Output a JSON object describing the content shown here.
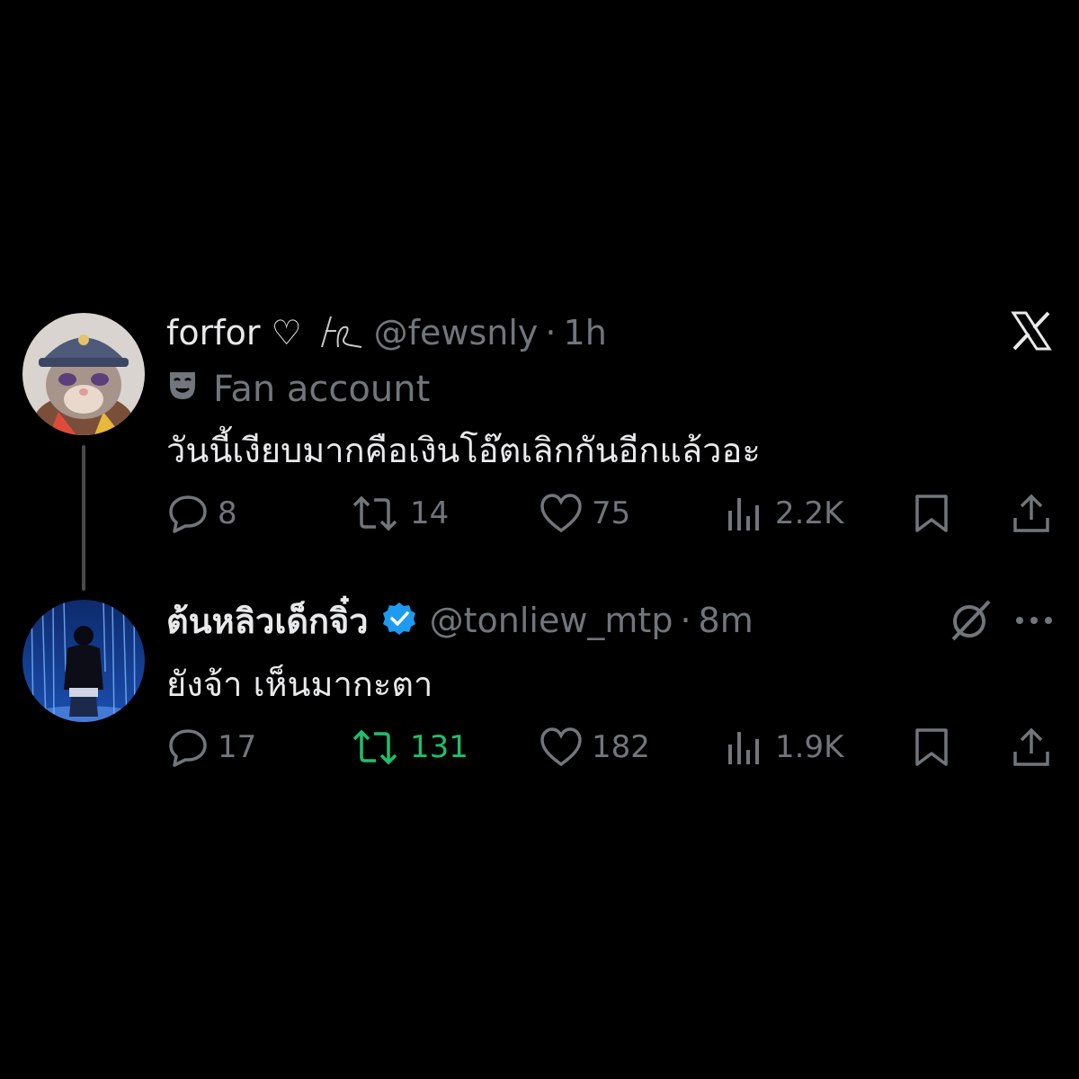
{
  "tweets": [
    {
      "display_name": "forfor ♡",
      "handle": "@fewsnly",
      "separator": "·",
      "time": "1h",
      "label": "Fan account",
      "label_icon": "theater-mask-icon",
      "text": "วันนี้เงียบมากคือเงินโอ๊ตเลิกกันอีกแล้วอะ",
      "stats": {
        "replies": "8",
        "reposts": "14",
        "likes": "75",
        "views": "2.2K"
      },
      "reposted": false
    },
    {
      "display_name": "ต้นหลิวเด็กจิ๋ว",
      "verified": true,
      "handle": "@tonliew_mtp",
      "separator": "·",
      "time": "8m",
      "text": "ยังจ้า เห็นมากะตา",
      "stats": {
        "replies": "17",
        "reposts": "131",
        "likes": "182",
        "views": "1.9K"
      },
      "reposted": true
    }
  ],
  "icons": [
    "x-logo-icon",
    "grok-icon",
    "more-icon",
    "reply-icon",
    "repost-icon",
    "like-icon",
    "views-icon",
    "bookmark-icon",
    "share-icon"
  ],
  "colors": {
    "background": "#000000",
    "text": "#e7e9ea",
    "muted": "#71767b",
    "repost_active": "#1fbf6b",
    "verified": "#1d9bf0"
  }
}
